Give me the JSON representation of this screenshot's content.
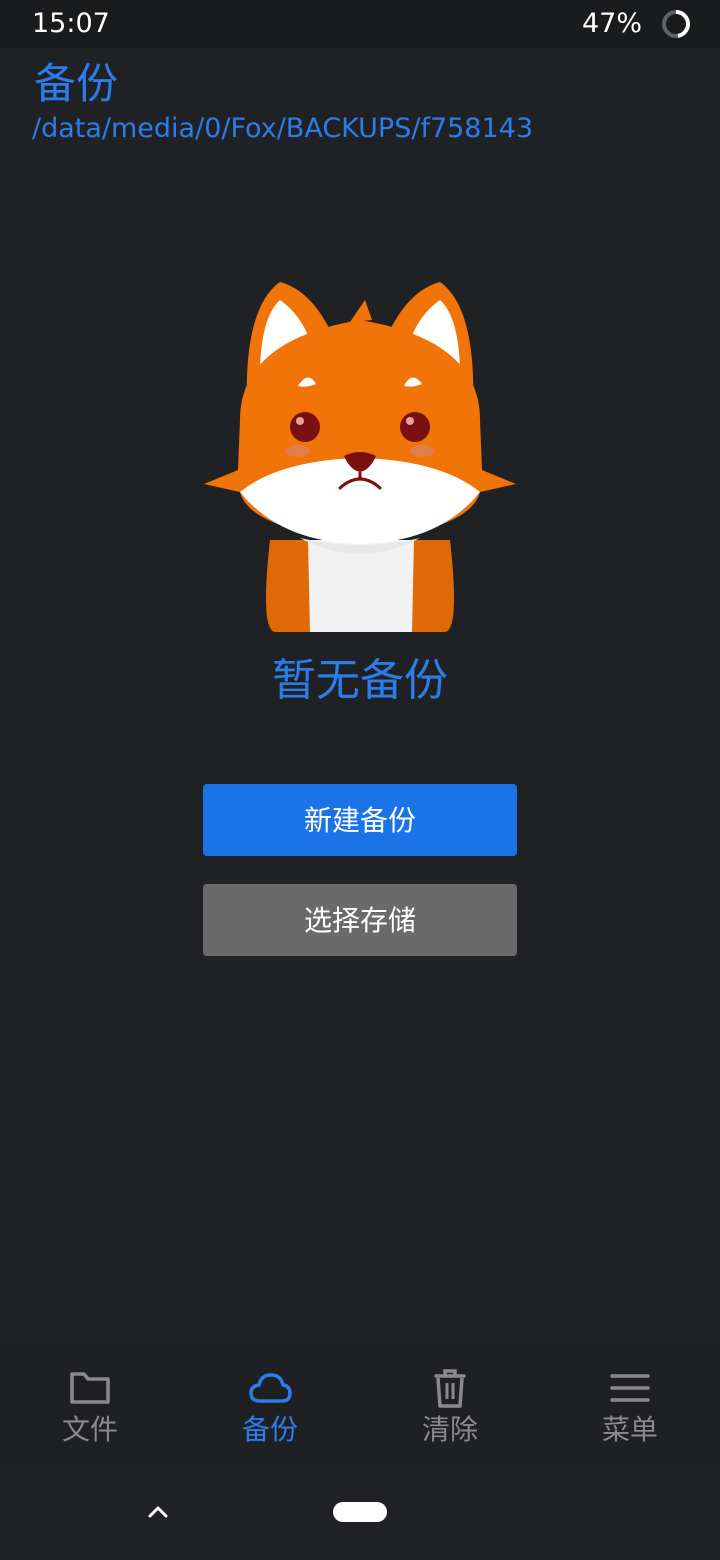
{
  "status_bar": {
    "time": "15:07",
    "battery": "47%",
    "battery_level": 0.47
  },
  "header": {
    "title": "备份",
    "path": "/data/media/0/Fox/BACKUPS/f758143"
  },
  "empty_state": {
    "mascot_icon": "sad-fox-illustration",
    "message": "暂无备份"
  },
  "actions": {
    "new_backup_label": "新建备份",
    "select_storage_label": "选择存储"
  },
  "bottom_nav": {
    "items": [
      {
        "label": "文件",
        "icon": "folder-icon",
        "active": false
      },
      {
        "label": "备份",
        "icon": "cloud-icon",
        "active": true
      },
      {
        "label": "清除",
        "icon": "trash-icon",
        "active": false
      },
      {
        "label": "菜单",
        "icon": "menu-icon",
        "active": false
      }
    ]
  },
  "colors": {
    "accent": "#2b7de9",
    "primary_button": "#1b73e8",
    "secondary_button": "#6a6a6a",
    "background": "#202124",
    "inactive": "#8a8a8a"
  }
}
